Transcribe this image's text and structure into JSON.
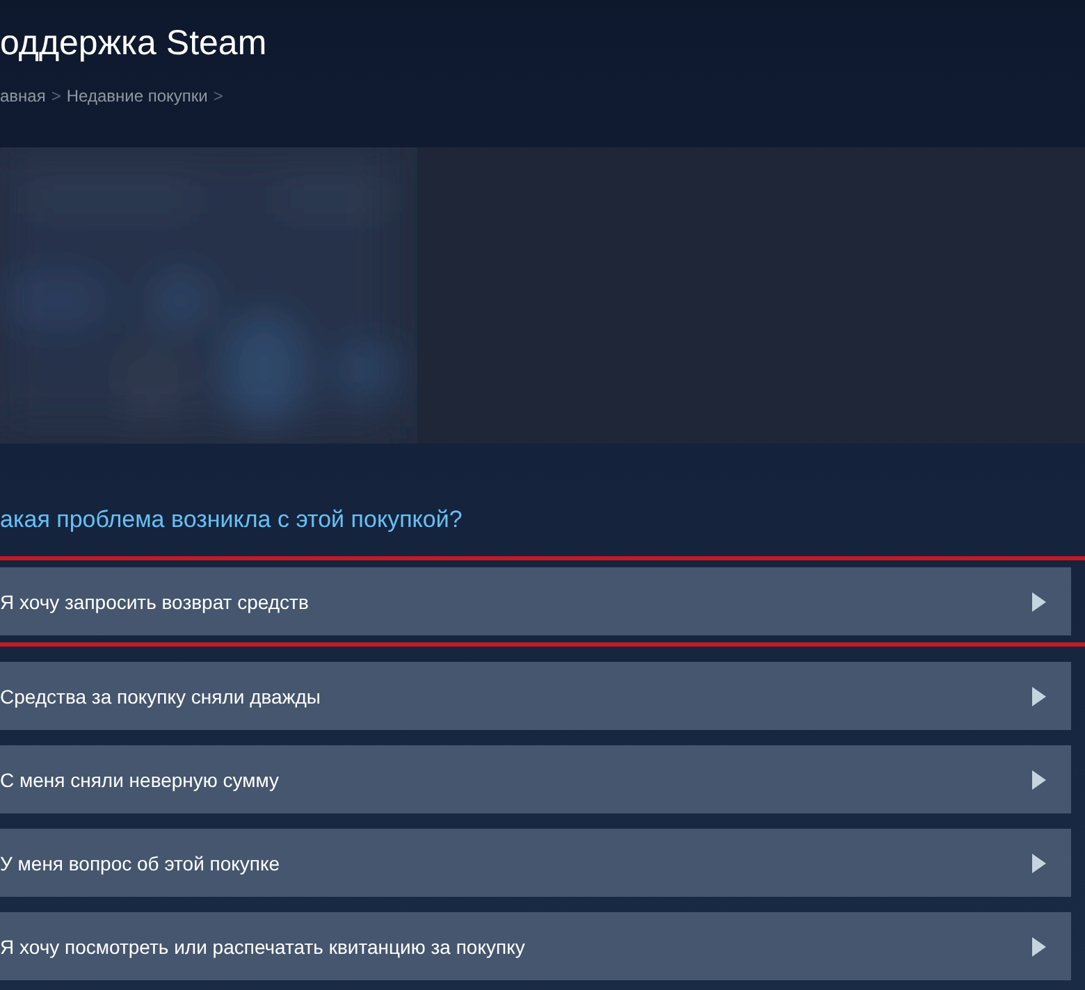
{
  "header": {
    "title": "оддержка Steam",
    "breadcrumbs": [
      {
        "label": "авная"
      },
      {
        "label": "Недавние покупки"
      }
    ],
    "separator": ">"
  },
  "question": "акая проблема возникла с этой покупкой?",
  "options": [
    {
      "label": "Я хочу запросить возврат средств",
      "highlighted": true
    },
    {
      "label": "Средства за покупку сняли дважды",
      "highlighted": false
    },
    {
      "label": "С меня сняли неверную сумму",
      "highlighted": false
    },
    {
      "label": "У меня вопрос об этой покупке",
      "highlighted": false
    },
    {
      "label": "Я хочу посмотреть или распечатать квитанцию за покупку",
      "highlighted": false
    }
  ]
}
